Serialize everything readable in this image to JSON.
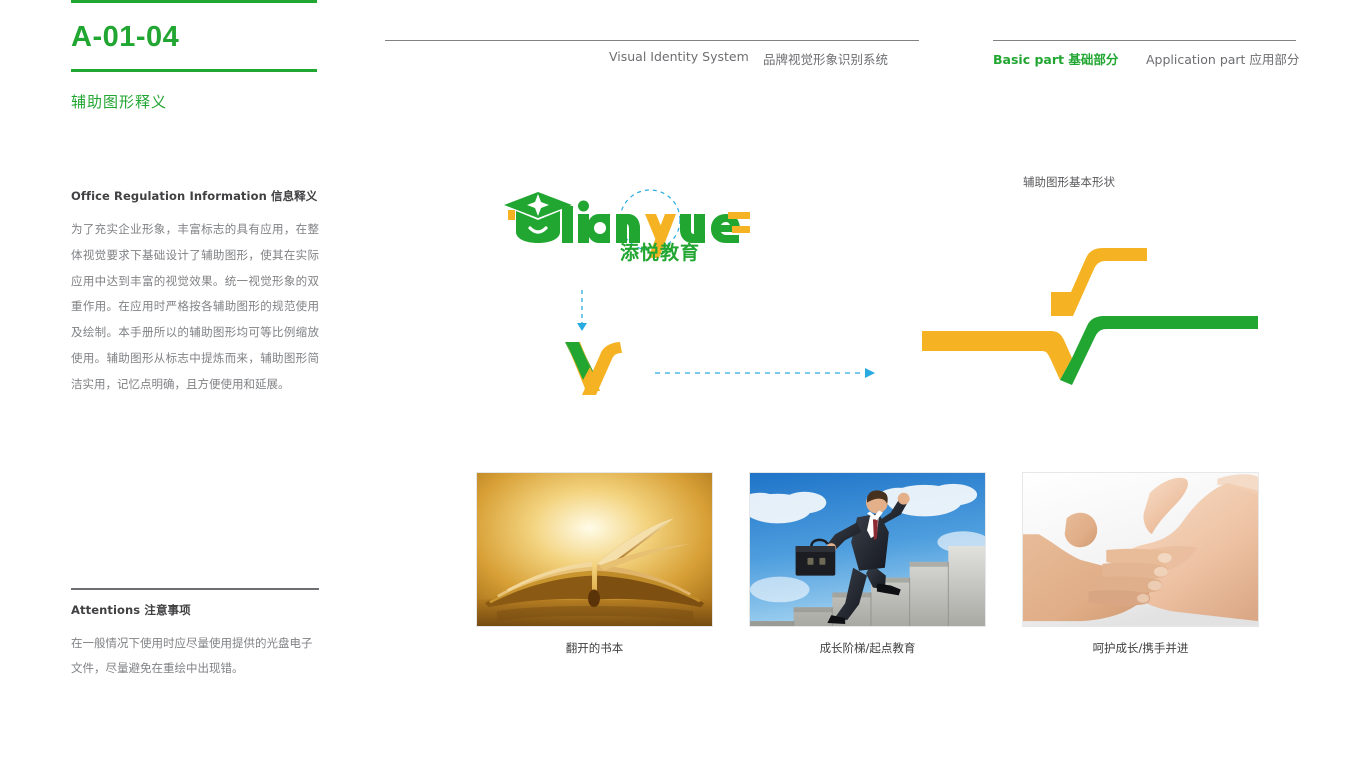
{
  "page": {
    "code": "A-01-04",
    "section_title": "辅助图形释义"
  },
  "header": {
    "visual_identity_en": "Visual Identity System",
    "visual_identity_cn": "品牌视觉形象识别系统",
    "basic_part": "Basic part  基础部分",
    "application_part": "Application part  应用部分"
  },
  "info": {
    "heading": "Office Regulation Information  信息释义",
    "body": "为了充实企业形象，丰富标志的具有应用，在整体视觉要求下基础设计了辅助图形，使其在实际应用中达到丰富的视觉效果。统一视觉形象的双重作用。在应用时严格按各辅助图形的规范使用及绘制。本手册所以的辅助图形均可等比例缩放使用。辅助图形从标志中提炼而来，辅助图形简洁实用，记忆点明确，且方便使用和延展。"
  },
  "attentions": {
    "heading": "Attentions 注意事项",
    "body": "在一般情况下使用时应尽量使用提供的光盘电子文件，尽量避免在重绘中出现错。"
  },
  "logo": {
    "wordmark": "tianyue",
    "caption_cn": "添悦教育",
    "cap_icon": "graduation-cap-icon"
  },
  "shapes": {
    "title": "辅助图形基本形状"
  },
  "photos": [
    {
      "caption": "翻开的书本",
      "alt": "open-book-photo"
    },
    {
      "caption": "成长阶梯/起点教育",
      "alt": "businessman-climbing-stairs-photo"
    },
    {
      "caption": "呵护成长/携手并进",
      "alt": "adult-and-child-hands-photo"
    }
  ],
  "colors": {
    "green": "#22a632",
    "orange": "#f5b324",
    "blue_dashed": "#29abe2",
    "grey_text": "#808285",
    "dark_text": "#414042"
  }
}
